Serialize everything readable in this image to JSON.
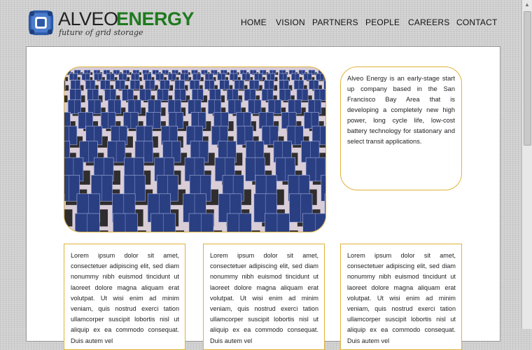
{
  "brand": {
    "name_part1": "ALVEO",
    "name_part2": "ENERGY",
    "tagline": "future of grid storage",
    "colors": {
      "energy_green": "#1f7a1f",
      "logo_blue": "#2c5aa8",
      "accent_border": "#e0b23a"
    }
  },
  "nav": {
    "items": [
      {
        "label": "HOME"
      },
      {
        "label": "VISION"
      },
      {
        "label": "PARTNERS"
      },
      {
        "label": "PEOPLE"
      },
      {
        "label": "CAREERS"
      },
      {
        "label": "CONTACT"
      }
    ]
  },
  "hero": {
    "image": "solar-panel-array-image"
  },
  "intro": {
    "text": "Alveo Energy is an early-stage start up company based in the San Francisco Bay Area that is developing a completely new high power, long cycle life, low-cost battery technology for stationary and select transit applications."
  },
  "cards": [
    {
      "text": "Lorem ipsum dolor sit amet, consectetuer adipiscing elit, sed diam nonummy nibh euismod tincidunt ut laoreet dolore magna aliquam erat volutpat. Ut wisi enim ad minim veniam, quis nostrud exerci tation ullamcorper suscipit lobortis nisl ut aliquip ex ea commodo consequat. Duis autem vel"
    },
    {
      "text": "Lorem ipsum dolor sit amet, consectetuer adipiscing elit, sed diam nonummy nibh euismod tincidunt ut laoreet dolore magna aliquam erat volutpat. Ut wisi enim ad minim veniam, quis nostrud exerci tation ullamcorper suscipit lobortis nisl ut aliquip ex ea commodo consequat. Duis autem vel"
    },
    {
      "text": "Lorem ipsum dolor sit amet, consectetuer adipiscing elit, sed diam nonummy nibh euismod tincidunt ut laoreet dolore magna aliquam erat volutpat. Ut wisi enim ad minim veniam, quis nostrud exerci tation ullamcorper suscipit lobortis nisl ut aliquip ex ea commodo consequat. Duis autem vel"
    }
  ]
}
